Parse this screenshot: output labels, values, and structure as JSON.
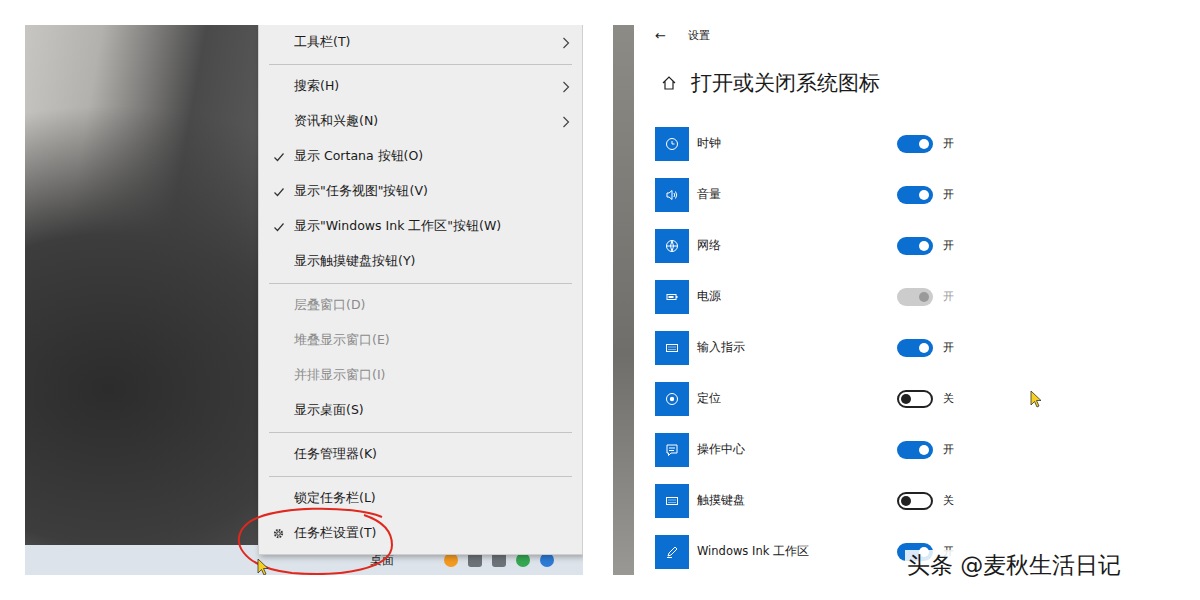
{
  "taskbar_menu": {
    "items": [
      {
        "kind": "item",
        "label": "工具栏(T)",
        "checked": false,
        "disabled": false,
        "submenu": true,
        "highlighted": false
      },
      {
        "kind": "separator"
      },
      {
        "kind": "item",
        "label": "搜索(H)",
        "checked": false,
        "disabled": false,
        "submenu": true,
        "highlighted": false
      },
      {
        "kind": "item",
        "label": "资讯和兴趣(N)",
        "checked": false,
        "disabled": false,
        "submenu": true,
        "highlighted": false
      },
      {
        "kind": "item",
        "label": "显示 Cortana 按钮(O)",
        "checked": true,
        "disabled": false,
        "submenu": false,
        "highlighted": false
      },
      {
        "kind": "item",
        "label": "显示\"任务视图\"按钮(V)",
        "checked": true,
        "disabled": false,
        "submenu": false,
        "highlighted": false
      },
      {
        "kind": "item",
        "label": "显示\"Windows Ink 工作区\"按钮(W)",
        "checked": true,
        "disabled": false,
        "submenu": false,
        "highlighted": false
      },
      {
        "kind": "item",
        "label": "显示触摸键盘按钮(Y)",
        "checked": false,
        "disabled": false,
        "submenu": false,
        "highlighted": false
      },
      {
        "kind": "separator"
      },
      {
        "kind": "item",
        "label": "层叠窗口(D)",
        "checked": false,
        "disabled": true,
        "submenu": false,
        "highlighted": false
      },
      {
        "kind": "item",
        "label": "堆叠显示窗口(E)",
        "checked": false,
        "disabled": true,
        "submenu": false,
        "highlighted": false
      },
      {
        "kind": "item",
        "label": "并排显示窗口(I)",
        "checked": false,
        "disabled": true,
        "submenu": false,
        "highlighted": false
      },
      {
        "kind": "item",
        "label": "显示桌面(S)",
        "checked": false,
        "disabled": false,
        "submenu": false,
        "highlighted": false
      },
      {
        "kind": "separator"
      },
      {
        "kind": "item",
        "label": "任务管理器(K)",
        "checked": false,
        "disabled": false,
        "submenu": false,
        "highlighted": false
      },
      {
        "kind": "separator"
      },
      {
        "kind": "item",
        "label": "锁定任务栏(L)",
        "checked": false,
        "disabled": false,
        "submenu": false,
        "highlighted": false
      },
      {
        "kind": "item",
        "label": "任务栏设置(T)",
        "checked": false,
        "disabled": false,
        "submenu": false,
        "highlighted": true
      }
    ]
  },
  "taskbar": {
    "label": "桌面"
  },
  "settings": {
    "back": "←",
    "breadcrumb": "设置",
    "title": "打开或关闭系统图标",
    "rows": [
      {
        "name": "时钟",
        "on": true,
        "disabled": false,
        "state_label": "开"
      },
      {
        "name": "音量",
        "on": true,
        "disabled": false,
        "state_label": "开"
      },
      {
        "name": "网络",
        "on": true,
        "disabled": false,
        "state_label": "开"
      },
      {
        "name": "电源",
        "on": true,
        "disabled": true,
        "state_label": "开"
      },
      {
        "name": "输入指示",
        "on": true,
        "disabled": false,
        "state_label": "开"
      },
      {
        "name": "定位",
        "on": false,
        "disabled": false,
        "state_label": "关"
      },
      {
        "name": "操作中心",
        "on": true,
        "disabled": false,
        "state_label": "开"
      },
      {
        "name": "触摸键盘",
        "on": false,
        "disabled": false,
        "state_label": "关"
      },
      {
        "name": "Windows Ink 工作区",
        "on": true,
        "disabled": false,
        "state_label": "开"
      }
    ]
  },
  "watermark": "头条 @麦秋生活日记"
}
